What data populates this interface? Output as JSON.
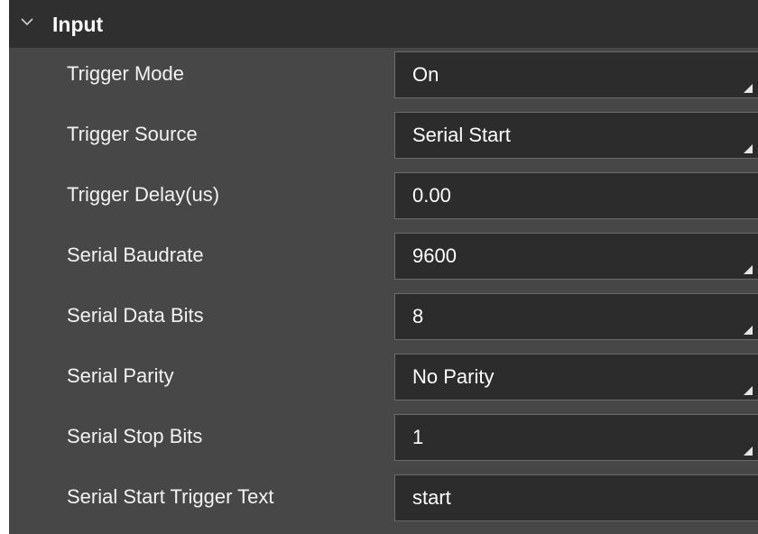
{
  "section": {
    "title": "Input"
  },
  "rows": [
    {
      "label": "Trigger Mode",
      "value": "On",
      "dropdown": true
    },
    {
      "label": "Trigger Source",
      "value": "Serial Start",
      "dropdown": true
    },
    {
      "label": "Trigger Delay(us)",
      "value": "0.00",
      "dropdown": false
    },
    {
      "label": "Serial Baudrate",
      "value": "9600",
      "dropdown": true
    },
    {
      "label": "Serial Data Bits",
      "value": "8",
      "dropdown": true
    },
    {
      "label": "Serial Parity",
      "value": "No Parity",
      "dropdown": true
    },
    {
      "label": "Serial Stop Bits",
      "value": "1",
      "dropdown": true
    },
    {
      "label": "Serial Start Trigger Text",
      "value": "start",
      "dropdown": false
    }
  ],
  "colors": {
    "panel_background": "#474747",
    "header_background": "#2f2f2f",
    "field_background": "#2c2c2c",
    "field_border": "#6b6b6b",
    "text": "#ffffff"
  },
  "icons": {
    "section_toggle": "chevron-down-icon",
    "dropdown": "dropdown-arrow-icon"
  }
}
